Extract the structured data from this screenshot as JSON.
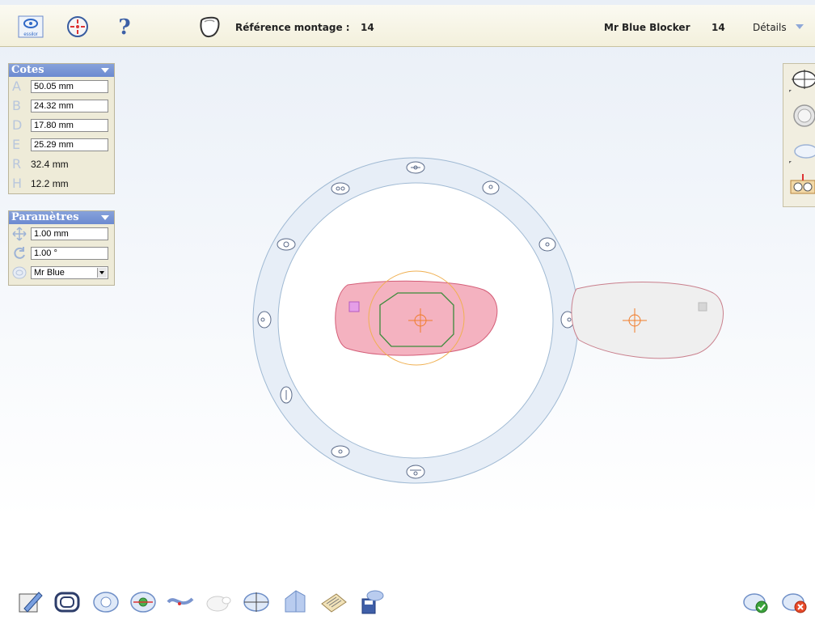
{
  "header": {
    "reference_label": "Référence montage :",
    "reference_value": "14",
    "frame_name": "Mr Blue Blocker",
    "frame_number": "14",
    "details_label": "Détails",
    "logo_text": "essilor"
  },
  "cotes_panel": {
    "title": "Cotes",
    "rows": [
      {
        "letter": "A",
        "value": "50.05 mm",
        "editable": true
      },
      {
        "letter": "B",
        "value": "24.32 mm",
        "editable": true
      },
      {
        "letter": "D",
        "value": "17.80 mm",
        "editable": true
      },
      {
        "letter": "E",
        "value": "25.29 mm",
        "editable": true
      },
      {
        "letter": "R",
        "value": "32.4 mm",
        "editable": false
      },
      {
        "letter": "H",
        "value": "12.2 mm",
        "editable": false
      }
    ]
  },
  "parametres_panel": {
    "title": "Paramètres",
    "step_value": "1.00 mm",
    "angle_value": "1.00 °",
    "model_select": "Mr Blue"
  },
  "colors": {
    "accent_blue": "#7491d4",
    "lens_fill": "#f4b2c0",
    "lens_stroke": "#d45e78",
    "crosshair": "#f07c2a",
    "inner_shape": "#3b8b3b",
    "ring_fill": "#e5edf6",
    "ring_stroke": "#9fb9d3"
  },
  "icons": {
    "top": [
      "essilor-logo-icon",
      "target-icon",
      "help-icon",
      "frame-icon"
    ],
    "right": [
      "lens-shape-icon",
      "lens-3d-icon",
      "lens-edge-icon",
      "glasses-calibrate-icon"
    ],
    "bottom": [
      "edit-pencil-icon",
      "frame-shape-icon",
      "lens-zoom-icon",
      "centering-icon",
      "curve-icon",
      "drill-icon",
      "blocker-icon",
      "bevel-icon",
      "scan-icon",
      "save-disk-icon"
    ],
    "actions": [
      "confirm-icon",
      "cancel-icon"
    ]
  }
}
